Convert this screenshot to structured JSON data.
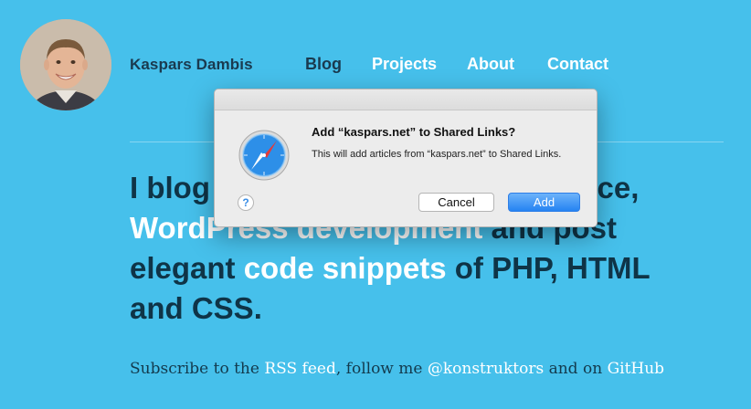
{
  "header": {
    "site_name": "Kaspars Dambis",
    "nav": [
      {
        "label": "Blog",
        "active": true
      },
      {
        "label": "Projects",
        "active": false
      },
      {
        "label": "About",
        "active": false
      },
      {
        "label": "Contact",
        "active": false
      }
    ]
  },
  "hero": {
    "line1_a": "I blog",
    "line1_b": "ance,",
    "line2_a": "WordPress development",
    "line2_b": " and post",
    "line3_a": "elegant ",
    "line3_b": "code snippets",
    "line3_c": " of PHP, HTML",
    "line4": "and CSS."
  },
  "subscribe": {
    "prefix": "Subscribe to the ",
    "rss_link": "RSS feed",
    "mid": ", follow me ",
    "twitter_link": "@konstruktors",
    "and": " and on ",
    "github_link": "GitHub"
  },
  "dialog": {
    "title": "Add “kaspars.net” to Shared Links?",
    "message": "This will add articles from “kaspars.net” to Shared Links.",
    "help_label": "?",
    "cancel_label": "Cancel",
    "add_label": "Add",
    "icon": "safari-compass-icon"
  },
  "colors": {
    "background": "#46c0eb",
    "dark_text": "#0f3447",
    "default_button": "#2583f2"
  }
}
